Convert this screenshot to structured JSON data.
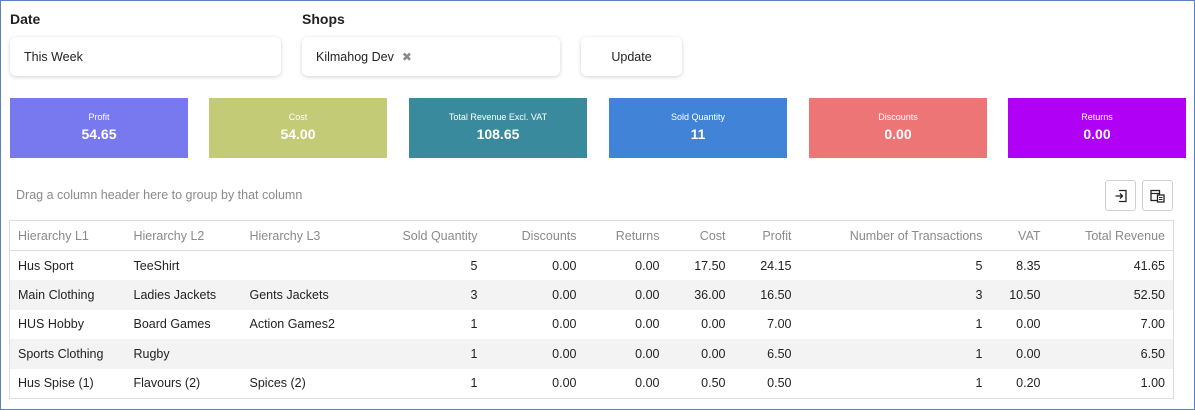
{
  "filters": {
    "date_label": "Date",
    "date_value": "This Week",
    "shops_label": "Shops",
    "shop_chip": "Kilmahog Dev",
    "update_label": "Update"
  },
  "cards": [
    {
      "label": "Profit",
      "value": "54.65",
      "color": "#7878ef"
    },
    {
      "label": "Cost",
      "value": "54.00",
      "color": "#c3cb77"
    },
    {
      "label": "Total Revenue Excl. VAT",
      "value": "108.65",
      "color": "#3a8a9e"
    },
    {
      "label": "Sold Quantity",
      "value": "11",
      "color": "#4183d7"
    },
    {
      "label": "Discounts",
      "value": "0.00",
      "color": "#ee7575"
    },
    {
      "label": "Returns",
      "value": "0.00",
      "color": "#b000f5"
    }
  ],
  "grid": {
    "group_hint": "Drag a column header here to group by that column",
    "toolbar_icons": [
      "export-icon",
      "column-chooser-icon"
    ],
    "columns": [
      "Hierarchy L1",
      "Hierarchy L2",
      "Hierarchy L3",
      "Sold Quantity",
      "Discounts",
      "Returns",
      "Cost",
      "Profit",
      "Number of Transactions",
      "VAT",
      "Total Revenue"
    ],
    "rows": [
      [
        "Hus Sport",
        "TeeShirt",
        "",
        "5",
        "0.00",
        "0.00",
        "17.50",
        "24.15",
        "5",
        "8.35",
        "41.65"
      ],
      [
        "Main Clothing",
        "Ladies Jackets",
        "Gents Jackets",
        "3",
        "0.00",
        "0.00",
        "36.00",
        "16.50",
        "3",
        "10.50",
        "52.50"
      ],
      [
        "HUS Hobby",
        "Board Games",
        "Action Games2",
        "1",
        "0.00",
        "0.00",
        "0.00",
        "7.00",
        "1",
        "0.00",
        "7.00"
      ],
      [
        "Sports Clothing",
        "Rugby",
        "",
        "1",
        "0.00",
        "0.00",
        "0.00",
        "6.50",
        "1",
        "0.00",
        "6.50"
      ],
      [
        "Hus Spise (1)",
        "Flavours (2)",
        "Spices (2)",
        "1",
        "0.00",
        "0.00",
        "0.50",
        "0.50",
        "1",
        "0.20",
        "1.00"
      ]
    ]
  }
}
